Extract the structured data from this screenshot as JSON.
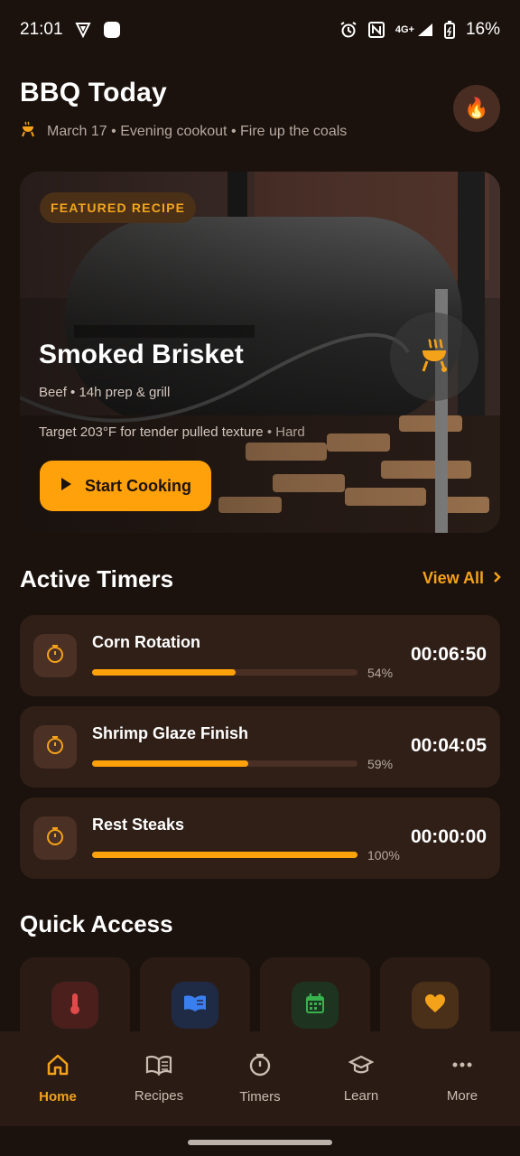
{
  "status_bar": {
    "time": "21:01",
    "battery": "16%",
    "network": "4G+"
  },
  "header": {
    "title": "BBQ Today",
    "subtitle": "March 17 • Evening cookout • Fire up the coals",
    "flame_icon": "flame-icon"
  },
  "featured": {
    "badge": "FEATURED RECIPE",
    "title": "Smoked Brisket",
    "meta": "Beef • 14h prep & grill",
    "desc_main": "Target 203°F for tender pulled texture",
    "desc_level": "• Hard",
    "cta": "Start Cooking"
  },
  "active_timers": {
    "title": "Active Timers",
    "view_all": "View All",
    "items": [
      {
        "name": "Corn Rotation",
        "percent": 54,
        "percent_label": "54%",
        "time": "00:06:50"
      },
      {
        "name": "Shrimp Glaze Finish",
        "percent": 59,
        "percent_label": "59%",
        "time": "00:04:05"
      },
      {
        "name": "Rest Steaks",
        "percent": 100,
        "percent_label": "100%",
        "time": "00:00:00"
      }
    ]
  },
  "quick_access": {
    "title": "Quick Access",
    "items": [
      {
        "icon": "thermometer-icon",
        "color": "#b83a3a"
      },
      {
        "icon": "book-icon",
        "color": "#2f6fd6"
      },
      {
        "icon": "calendar-icon",
        "color": "#2ea84a"
      },
      {
        "icon": "heart-icon",
        "color": "#f4a21a"
      }
    ]
  },
  "bottom_nav": {
    "items": [
      {
        "label": "Home",
        "icon": "home-icon",
        "active": true
      },
      {
        "label": "Recipes",
        "icon": "recipes-icon",
        "active": false
      },
      {
        "label": "Timers",
        "icon": "timer-icon",
        "active": false
      },
      {
        "label": "Learn",
        "icon": "learn-icon",
        "active": false
      },
      {
        "label": "More",
        "icon": "more-icon",
        "active": false
      }
    ]
  },
  "colors": {
    "accent": "#ffa10a",
    "background": "#1b120d",
    "card": "#2f1f17"
  }
}
